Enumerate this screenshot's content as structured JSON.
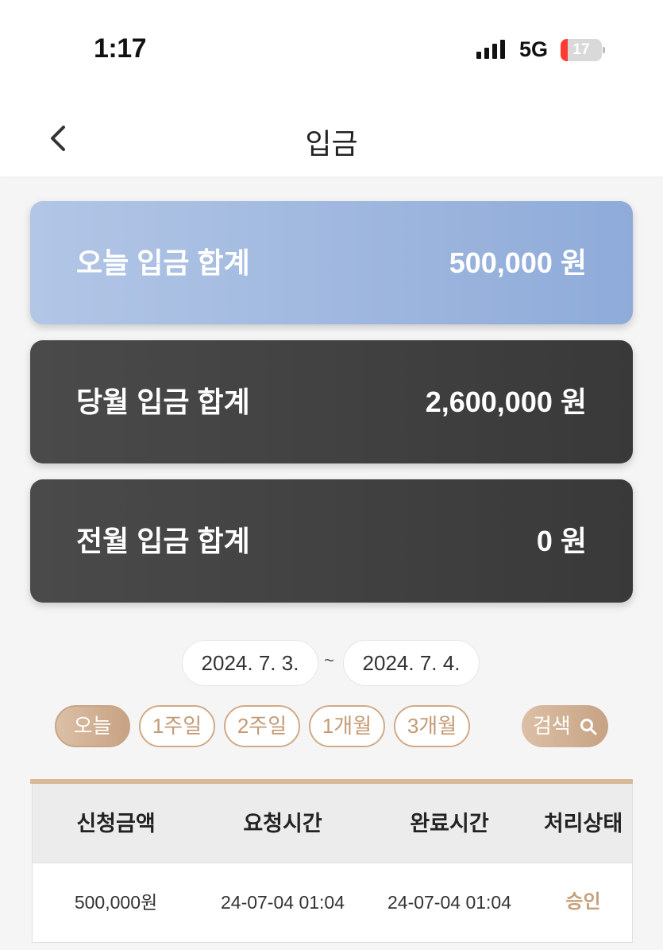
{
  "status_bar": {
    "time": "1:17",
    "network": "5G",
    "battery": "17",
    "battery_level": 0.17
  },
  "header": {
    "title": "입금",
    "back_icon": "chevron-left-icon"
  },
  "summary_cards": {
    "today": {
      "label": "오늘 입금 합계",
      "amount": "500,000 원"
    },
    "month": {
      "label": "당월 입금 합계",
      "amount": "2,600,000 원"
    },
    "prev_month": {
      "label": "전월 입금 합계",
      "amount": "0 원"
    }
  },
  "date_range": {
    "start": "2024. 7. 3.",
    "separator": "~",
    "end": "2024. 7. 4."
  },
  "period_filters": [
    "오늘",
    "1주일",
    "2주일",
    "1개월",
    "3개월"
  ],
  "active_filter": "오늘",
  "search": {
    "label": "검색",
    "icon": "search-icon"
  },
  "table": {
    "headers": [
      "신청금액",
      "요청시간",
      "완료시간",
      "처리상태"
    ],
    "rows": [
      [
        "500,000원",
        "24-07-04 01:04",
        "24-07-04 01:04",
        "승인"
      ]
    ]
  },
  "colors": {
    "accent": "#c7a283",
    "today_card": "#9fb8e0",
    "dark_card": "#424242",
    "status_approved": "#c7a07c",
    "battery_low": "#ff3b30"
  }
}
